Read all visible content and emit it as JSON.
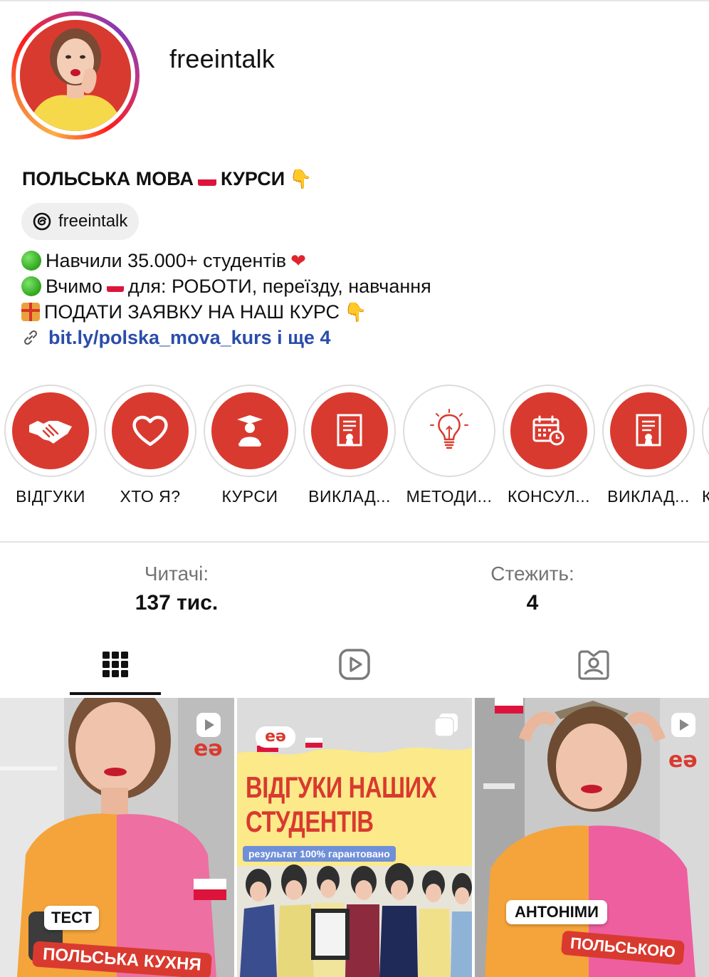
{
  "profile": {
    "username": "freeintalk",
    "bio_title_a": "ПОЛЬСЬКА МОВА",
    "bio_title_b": "КУРСИ",
    "threads_handle": "freeintalk",
    "bio_line_1": "Навчили 35.000+ студентів",
    "bio_line_2_a": "Вчимо",
    "bio_line_2_b": "для: РОБОТИ, переїзду, навчання",
    "bio_line_3": "ПОДАТИ ЗАЯВКУ НА НАШ КУРС",
    "link_text": "bit.ly/polska_mova_kurs і ще 4"
  },
  "highlights": [
    {
      "label": "ВІДГУКИ",
      "icon": "handshake-icon"
    },
    {
      "label": "ХТО Я?",
      "icon": "heart-icon"
    },
    {
      "label": "КУРСИ",
      "icon": "graduate-icon"
    },
    {
      "label": "ВИКЛАД...",
      "icon": "certificate-icon"
    },
    {
      "label": "МЕТОДИ...",
      "icon": "lightbulb-icon"
    },
    {
      "label": "КОНСУЛ...",
      "icon": "calendar-icon"
    },
    {
      "label": "ВИКЛАД...",
      "icon": "certificate-icon"
    },
    {
      "label": "К",
      "icon": "partial-highlight"
    }
  ],
  "stats": {
    "followers_label": "Читачі:",
    "followers_value": "137 тис.",
    "following_label": "Стежить:",
    "following_value": "4"
  },
  "tabs": [
    {
      "name": "posts",
      "icon": "grid-icon",
      "active": true
    },
    {
      "name": "reels",
      "icon": "reels-icon",
      "active": false
    },
    {
      "name": "tagged",
      "icon": "tagged-icon",
      "active": false
    }
  ],
  "posts": [
    {
      "type": "reel",
      "tag_text": "ТЕСТ",
      "caption": "ПОЛЬСЬКА КУХНЯ",
      "brand": "eə"
    },
    {
      "type": "carousel",
      "headline_1": "ВІДГУКИ НАШИХ",
      "headline_2": "СТУДЕНТІВ",
      "subline": "результат 100% гарантовано",
      "brand": "eə"
    },
    {
      "type": "reel",
      "tag_text": "АНТОНІМИ",
      "caption": "ПОЛЬСЬКОЮ",
      "brand": "eə"
    }
  ],
  "colors": {
    "brand_red": "#d93a2f",
    "link_blue": "#2a4dab",
    "muted": "#737373"
  }
}
